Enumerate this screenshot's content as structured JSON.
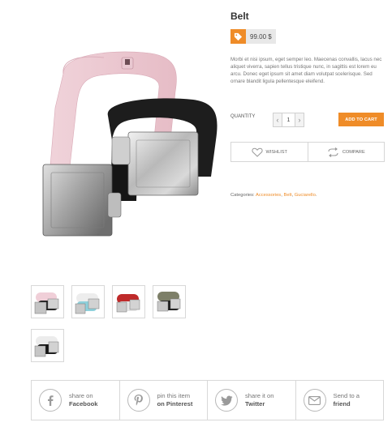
{
  "product": {
    "title": "Belt",
    "price": "99.00 $",
    "description": "Morbi et nisi ipsum, eget semper leo. Maecenas convallis, lacus nec aliquet viverra, sapien tellus tristique nunc, in sagittis est lorem eu arcu. Donec eget ipsum sit amet diam volutpat scelerisque. Sed ornare blandit ligula pellentesque eleifend.",
    "quantity_label": "QUANTITY",
    "quantity_value": "1",
    "decrement_symbol": "‹",
    "increment_symbol": "›",
    "add_to_cart_label": "ADD TO CART",
    "wishlist_label": "WISHLIST",
    "compare_label": "COMPARE",
    "categories_label": "Categories:",
    "categories": [
      "Accessories",
      "Belt",
      "Guciarello"
    ],
    "category_separator": ",",
    "categories_end": "."
  },
  "gallery": {
    "thumbnails": [
      {
        "icon": "pink-belt-thumbnail"
      },
      {
        "icon": "blue-belt-thumbnail"
      },
      {
        "icon": "red-belt-thumbnail"
      },
      {
        "icon": "olive-belt-thumbnail"
      },
      {
        "icon": "black-belt-thumbnail"
      }
    ]
  },
  "share": [
    {
      "line1": "share on",
      "line2": "Facebook",
      "icon": "facebook-icon"
    },
    {
      "line1": "pin this item",
      "line2": "on Pinterest",
      "icon": "pinterest-icon"
    },
    {
      "line1": "share it on",
      "line2": "Twitter",
      "icon": "twitter-icon"
    },
    {
      "line1": "Send to a",
      "line2": "friend",
      "icon": "mail-icon"
    }
  ],
  "colors": {
    "accent": "#ef8c28",
    "price_bg": "#e8e8e8",
    "border": "#d8d8d8"
  }
}
